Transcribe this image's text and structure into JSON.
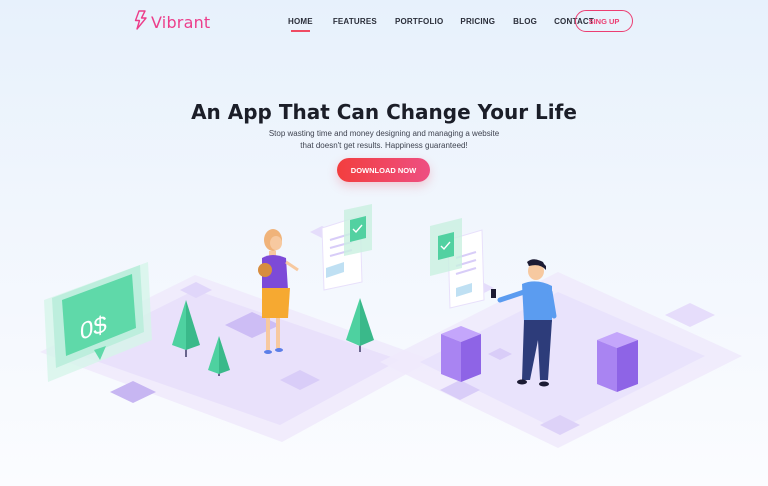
{
  "brand": {
    "name": "Vibrant",
    "icon": "lightning-bolt-icon",
    "color": "#ec3e8a"
  },
  "nav": {
    "items": [
      {
        "label": "HOME",
        "active": true
      },
      {
        "label": "FEATURES",
        "active": false
      },
      {
        "label": "PORTFOLIO",
        "active": false
      },
      {
        "label": "PRICING",
        "active": false
      },
      {
        "label": "BLOG",
        "active": false
      },
      {
        "label": "CONTACT",
        "active": false
      }
    ],
    "cta_label": "SING UP"
  },
  "hero": {
    "title": "An App That Can Change Your Life",
    "subtitle_line1": "Stop wasting time and money designing and managing a website",
    "subtitle_line2": "that doesn't get results. Happiness guaranteed!",
    "button_label": "DOWNLOAD NOW"
  },
  "illustration": {
    "screen_text": "0$",
    "colors": {
      "accent_green": "#4fd3a1",
      "accent_purple": "#a883ee",
      "accent_red": "#f23e3e",
      "accent_pink": "#ee4f82"
    }
  }
}
